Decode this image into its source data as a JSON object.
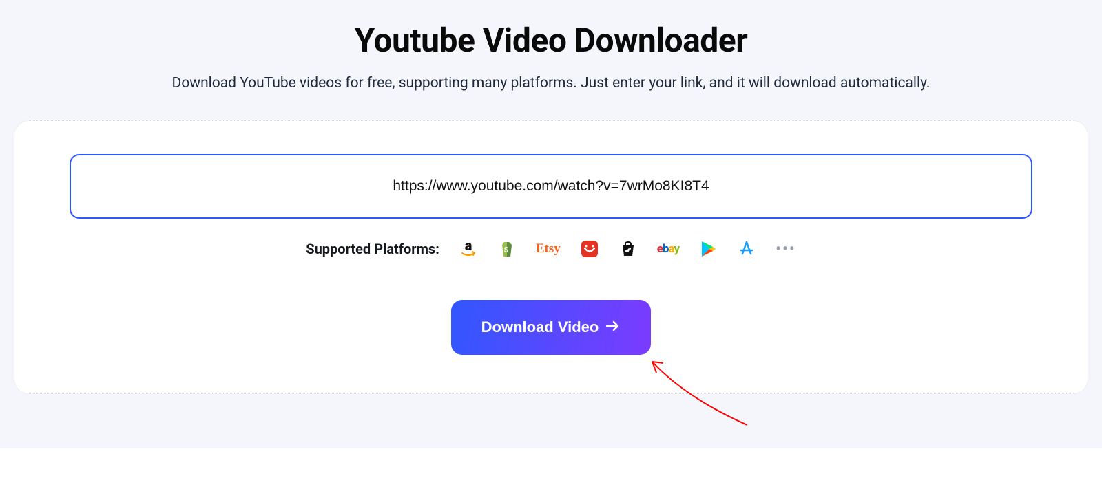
{
  "page": {
    "title": "Youtube Video Downloader",
    "subtitle": "Download YouTube videos for free, supporting many platforms. Just enter your link, and it will download automatically."
  },
  "input": {
    "value": "https://www.youtube.com/watch?v=7wrMo8KI8T4",
    "placeholder": ""
  },
  "platforms": {
    "label": "Supported Platforms:",
    "items": [
      {
        "name": "amazon"
      },
      {
        "name": "shopify"
      },
      {
        "name": "etsy",
        "text": "Etsy"
      },
      {
        "name": "aliexpress"
      },
      {
        "name": "tiktok-shop"
      },
      {
        "name": "ebay",
        "text": "ebay"
      },
      {
        "name": "google-play"
      },
      {
        "name": "app-store"
      }
    ]
  },
  "button": {
    "label": "Download Video"
  },
  "colors": {
    "accent_start": "#3157ff",
    "accent_end": "#7b3bff",
    "border_focus": "#2f55ff",
    "bg": "#f4f6fb"
  }
}
